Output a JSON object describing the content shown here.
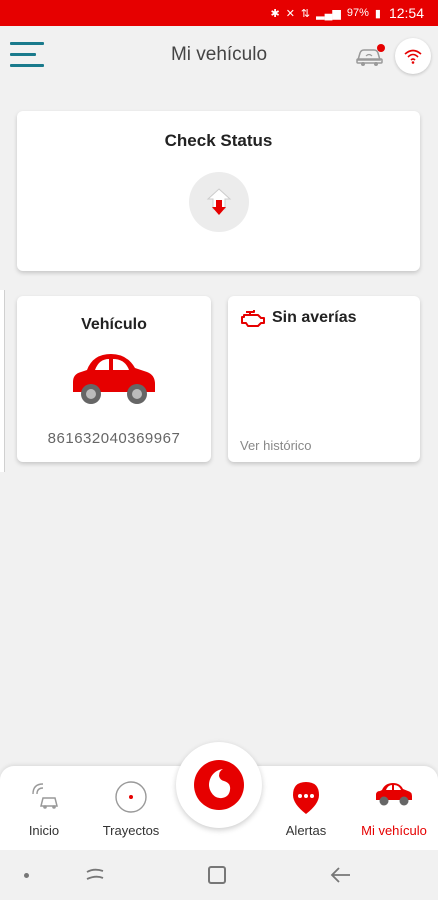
{
  "status_bar": {
    "battery": "97%",
    "time": "12:54"
  },
  "header": {
    "title": "Mi vehículo"
  },
  "check_card": {
    "title": "Check Status"
  },
  "vehicle_card": {
    "title": "Vehículo",
    "imei": "861632040369967"
  },
  "faults_card": {
    "title": "Sin averías",
    "history_link": "Ver histórico"
  },
  "bottom_nav": {
    "items": [
      {
        "label": "Inicio",
        "icon": "home-car-icon"
      },
      {
        "label": "Trayectos",
        "icon": "route-icon"
      },
      {
        "label": "Alertas",
        "icon": "alert-pin-icon"
      },
      {
        "label": "Mi vehículo",
        "icon": "car-icon",
        "active": true
      }
    ]
  },
  "colors": {
    "brand": "#e60000",
    "accent": "#1a7a8c",
    "background": "#f1f1f1"
  }
}
